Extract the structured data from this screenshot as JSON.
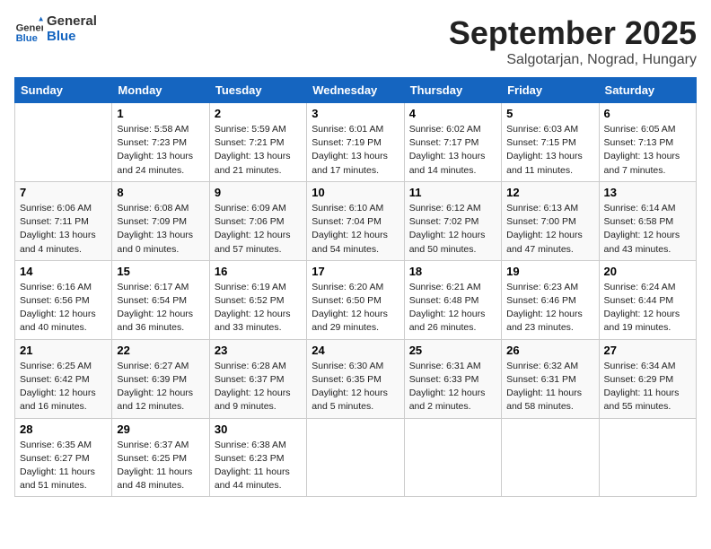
{
  "header": {
    "logo_line1": "General",
    "logo_line2": "Blue",
    "month_title": "September 2025",
    "location": "Salgotarjan, Nograd, Hungary"
  },
  "days_of_week": [
    "Sunday",
    "Monday",
    "Tuesday",
    "Wednesday",
    "Thursday",
    "Friday",
    "Saturday"
  ],
  "weeks": [
    [
      {
        "empty": true
      },
      {
        "day": "1",
        "sunrise": "5:58 AM",
        "sunset": "7:23 PM",
        "daylight": "13 hours and 24 minutes."
      },
      {
        "day": "2",
        "sunrise": "5:59 AM",
        "sunset": "7:21 PM",
        "daylight": "13 hours and 21 minutes."
      },
      {
        "day": "3",
        "sunrise": "6:01 AM",
        "sunset": "7:19 PM",
        "daylight": "13 hours and 17 minutes."
      },
      {
        "day": "4",
        "sunrise": "6:02 AM",
        "sunset": "7:17 PM",
        "daylight": "13 hours and 14 minutes."
      },
      {
        "day": "5",
        "sunrise": "6:03 AM",
        "sunset": "7:15 PM",
        "daylight": "13 hours and 11 minutes."
      },
      {
        "day": "6",
        "sunrise": "6:05 AM",
        "sunset": "7:13 PM",
        "daylight": "13 hours and 7 minutes."
      }
    ],
    [
      {
        "day": "7",
        "sunrise": "6:06 AM",
        "sunset": "7:11 PM",
        "daylight": "13 hours and 4 minutes."
      },
      {
        "day": "8",
        "sunrise": "6:08 AM",
        "sunset": "7:09 PM",
        "daylight": "13 hours and 0 minutes."
      },
      {
        "day": "9",
        "sunrise": "6:09 AM",
        "sunset": "7:06 PM",
        "daylight": "12 hours and 57 minutes."
      },
      {
        "day": "10",
        "sunrise": "6:10 AM",
        "sunset": "7:04 PM",
        "daylight": "12 hours and 54 minutes."
      },
      {
        "day": "11",
        "sunrise": "6:12 AM",
        "sunset": "7:02 PM",
        "daylight": "12 hours and 50 minutes."
      },
      {
        "day": "12",
        "sunrise": "6:13 AM",
        "sunset": "7:00 PM",
        "daylight": "12 hours and 47 minutes."
      },
      {
        "day": "13",
        "sunrise": "6:14 AM",
        "sunset": "6:58 PM",
        "daylight": "12 hours and 43 minutes."
      }
    ],
    [
      {
        "day": "14",
        "sunrise": "6:16 AM",
        "sunset": "6:56 PM",
        "daylight": "12 hours and 40 minutes."
      },
      {
        "day": "15",
        "sunrise": "6:17 AM",
        "sunset": "6:54 PM",
        "daylight": "12 hours and 36 minutes."
      },
      {
        "day": "16",
        "sunrise": "6:19 AM",
        "sunset": "6:52 PM",
        "daylight": "12 hours and 33 minutes."
      },
      {
        "day": "17",
        "sunrise": "6:20 AM",
        "sunset": "6:50 PM",
        "daylight": "12 hours and 29 minutes."
      },
      {
        "day": "18",
        "sunrise": "6:21 AM",
        "sunset": "6:48 PM",
        "daylight": "12 hours and 26 minutes."
      },
      {
        "day": "19",
        "sunrise": "6:23 AM",
        "sunset": "6:46 PM",
        "daylight": "12 hours and 23 minutes."
      },
      {
        "day": "20",
        "sunrise": "6:24 AM",
        "sunset": "6:44 PM",
        "daylight": "12 hours and 19 minutes."
      }
    ],
    [
      {
        "day": "21",
        "sunrise": "6:25 AM",
        "sunset": "6:42 PM",
        "daylight": "12 hours and 16 minutes."
      },
      {
        "day": "22",
        "sunrise": "6:27 AM",
        "sunset": "6:39 PM",
        "daylight": "12 hours and 12 minutes."
      },
      {
        "day": "23",
        "sunrise": "6:28 AM",
        "sunset": "6:37 PM",
        "daylight": "12 hours and 9 minutes."
      },
      {
        "day": "24",
        "sunrise": "6:30 AM",
        "sunset": "6:35 PM",
        "daylight": "12 hours and 5 minutes."
      },
      {
        "day": "25",
        "sunrise": "6:31 AM",
        "sunset": "6:33 PM",
        "daylight": "12 hours and 2 minutes."
      },
      {
        "day": "26",
        "sunrise": "6:32 AM",
        "sunset": "6:31 PM",
        "daylight": "11 hours and 58 minutes."
      },
      {
        "day": "27",
        "sunrise": "6:34 AM",
        "sunset": "6:29 PM",
        "daylight": "11 hours and 55 minutes."
      }
    ],
    [
      {
        "day": "28",
        "sunrise": "6:35 AM",
        "sunset": "6:27 PM",
        "daylight": "11 hours and 51 minutes."
      },
      {
        "day": "29",
        "sunrise": "6:37 AM",
        "sunset": "6:25 PM",
        "daylight": "11 hours and 48 minutes."
      },
      {
        "day": "30",
        "sunrise": "6:38 AM",
        "sunset": "6:23 PM",
        "daylight": "11 hours and 44 minutes."
      },
      {
        "empty": true
      },
      {
        "empty": true
      },
      {
        "empty": true
      },
      {
        "empty": true
      }
    ]
  ],
  "labels": {
    "sunrise": "Sunrise:",
    "sunset": "Sunset:",
    "daylight": "Daylight:"
  }
}
